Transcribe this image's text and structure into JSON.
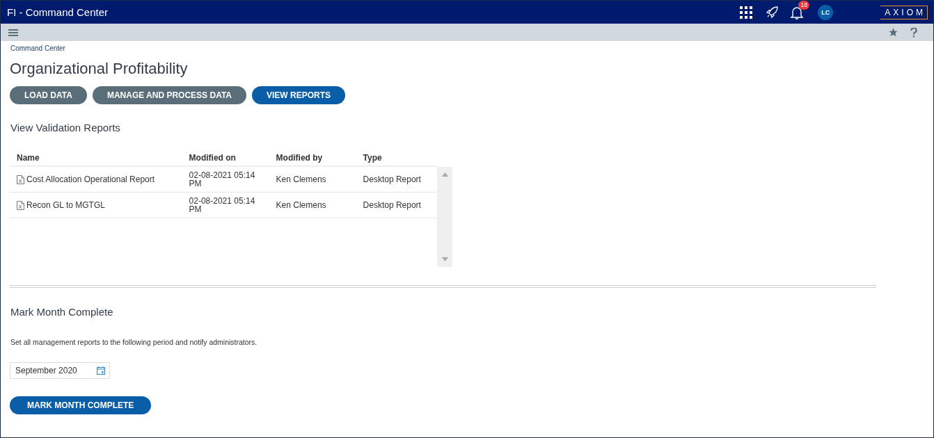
{
  "window": {
    "title": "FI - Command Center"
  },
  "header": {
    "notification_count": "18",
    "avatar_initials": "LC",
    "logo": "AXIOM"
  },
  "breadcrumb": "Command Center",
  "page_title": "Organizational Profitability",
  "tabs": [
    {
      "label": "LOAD DATA",
      "selected": false
    },
    {
      "label": "MANAGE AND PROCESS DATA",
      "selected": false
    },
    {
      "label": "VIEW REPORTS",
      "selected": true
    }
  ],
  "reports": {
    "title": "View Validation Reports",
    "columns": [
      "Name",
      "Modified on",
      "Modified by",
      "Type"
    ],
    "rows": [
      {
        "name": "Cost Allocation Operational Report",
        "modified_on": "02-08-2021 05:14 PM",
        "modified_by": "Ken Clemens",
        "type": "Desktop Report"
      },
      {
        "name": "Recon GL to MGTGL",
        "modified_on": "02-08-2021 05:14 PM",
        "modified_by": "Ken Clemens",
        "type": "Desktop Report"
      }
    ]
  },
  "month_complete": {
    "title": "Mark Month Complete",
    "description": "Set all management reports to the following period and notify administrators.",
    "period": "September 2020",
    "button": "MARK MONTH COMPLETE"
  }
}
